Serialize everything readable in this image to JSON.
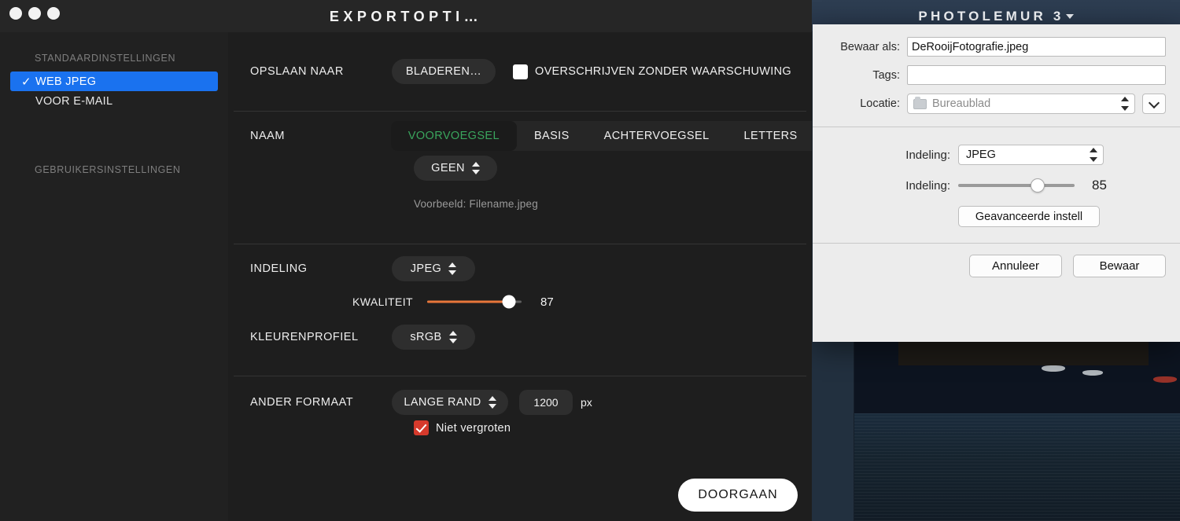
{
  "export_window": {
    "title": "EXPORTOPTI…",
    "traffic_lights": [
      "close",
      "minimize",
      "zoom"
    ],
    "sidebar": {
      "section_presets_label": "STANDAARDINSTELLINGEN",
      "section_user_label": "GEBRUIKERSINSTELLINGEN",
      "presets": [
        {
          "label": "WEB JPEG",
          "selected": true,
          "check": "✓"
        },
        {
          "label": "VOOR E-MAIL",
          "selected": false,
          "check": ""
        }
      ],
      "user_presets": []
    },
    "save_to": {
      "label": "OPSLAAN NAAR",
      "browse_button": "BLADEREN…",
      "overwrite_checkbox_label": "OVERSCHRIJVEN ZONDER WAARSCHUWING",
      "overwrite_checked": false
    },
    "name": {
      "label": "NAAM",
      "tabs": [
        {
          "label": "VOORVOEGSEL",
          "active": true
        },
        {
          "label": "BASIS",
          "active": false
        },
        {
          "label": "ACHTERVOEGSEL",
          "active": false
        },
        {
          "label": "LETTERS",
          "active": false
        }
      ],
      "prefix_select_value": "GEEN",
      "preview": "Voorbeeld: Filename.jpeg"
    },
    "format": {
      "label": "INDELING",
      "format_select_value": "JPEG",
      "quality_label": "KWALITEIT",
      "quality_value": "87",
      "quality_percent": 87,
      "color_profile_label": "KLEURENPROFIEL",
      "color_profile_value": "sRGB"
    },
    "resize": {
      "label": "ANDER FORMAAT",
      "mode_value": "LANGE RAND",
      "size_value": "1200",
      "unit": "px",
      "no_enlarge_label": "Niet vergroten",
      "no_enlarge_checked": true
    },
    "continue_button": "DOORGAAN",
    "colors": {
      "accent_selected": "#1a72ef",
      "accent_tab_active_text": "#3aa55d",
      "quality_slider": "#e8763a",
      "checkbox_red": "#d63a2c",
      "window_background": "#1e1e1e"
    }
  },
  "photo_app": {
    "title": "PHOTOLEMUR 3",
    "title_menu_icon": "caret-down-icon"
  },
  "save_dialog": {
    "save_as_label": "Bewaar als:",
    "save_as_value": "DeRooijFotografie.jpeg",
    "tags_label": "Tags:",
    "tags_value": "",
    "location_label": "Locatie:",
    "location_value": "Bureaublad",
    "location_icon": "folder-icon",
    "expand_icon": "chevron-down-icon",
    "format_label": "Indeling:",
    "format_value": "JPEG",
    "quality_label": "Indeling:",
    "quality_value": "85",
    "quality_percent": 68,
    "advanced_button": "Geavanceerde instell",
    "cancel_button": "Annuleer",
    "save_button": "Bewaar"
  }
}
